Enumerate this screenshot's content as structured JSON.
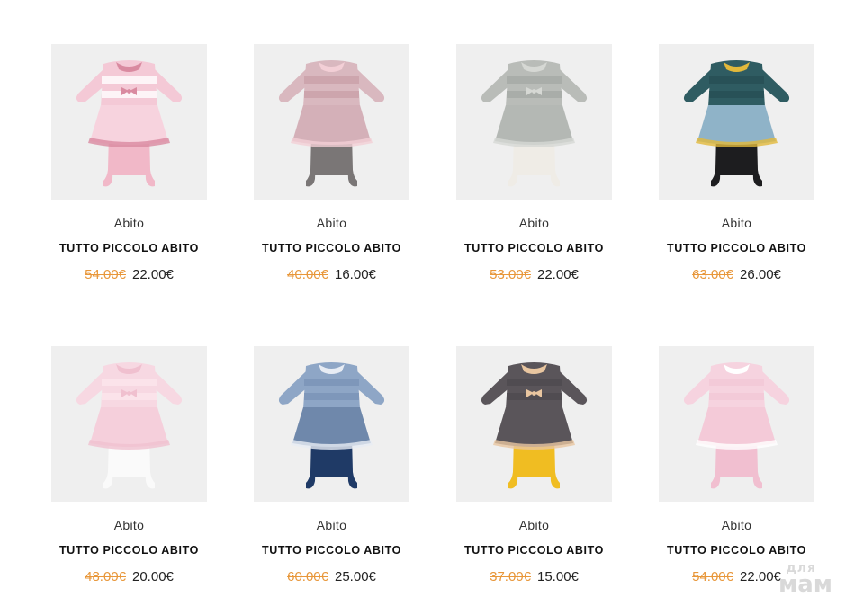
{
  "products": [
    {
      "category": "Abito",
      "brand": "TUTTO PICCOLO ABITO",
      "old_price": "54.00€",
      "price": "22.00€",
      "image": "pink-striped-tulle-dress",
      "colors": {
        "top": "#f4c9d6",
        "top2": "#ffffff",
        "skirt": "#f7d3de",
        "tights": "#f1b8c8",
        "accent": "#d98aa0"
      }
    },
    {
      "category": "Abito",
      "brand": "TUTTO PICCOLO ABITO",
      "old_price": "40.00€",
      "price": "16.00€",
      "image": "pink-houndstooth-dress",
      "colors": {
        "top": "#d9b8bf",
        "top2": "#c9a0a9",
        "skirt": "#d4b0b8",
        "tights": "#7a7676",
        "accent": "#f3cfd6"
      }
    },
    {
      "category": "Abito",
      "brand": "TUTTO PICCOLO ABITO",
      "old_price": "53.00€",
      "price": "22.00€",
      "image": "grey-check-dress",
      "colors": {
        "top": "#b9bcb8",
        "top2": "#a5a9a5",
        "skirt": "#b4b8b4",
        "tights": "#efece6",
        "accent": "#d6d8d4"
      }
    },
    {
      "category": "Abito",
      "brand": "TUTTO PICCOLO ABITO",
      "old_price": "63.00€",
      "price": "26.00€",
      "image": "teal-bow-dress",
      "colors": {
        "top": "#2f5c62",
        "top2": "#274f55",
        "skirt": "#8fb3c8",
        "tights": "#1d1d1f",
        "accent": "#e2b93b"
      }
    },
    {
      "category": "Abito",
      "brand": "TUTTO PICCOLO ABITO",
      "old_price": "48.00€",
      "price": "20.00€",
      "image": "light-pink-bow-dress",
      "colors": {
        "top": "#f7d8e2",
        "top2": "#fbe6ec",
        "skirt": "#f5cfdb",
        "tights": "#fafafa",
        "accent": "#f0c0cf"
      }
    },
    {
      "category": "Abito",
      "brand": "TUTTO PICCOLO ABITO",
      "old_price": "60.00€",
      "price": "25.00€",
      "image": "blue-knit-dress",
      "colors": {
        "top": "#8ea6c6",
        "top2": "#7a93b6",
        "skirt": "#6f88ab",
        "tights": "#1f3a66",
        "accent": "#e7ecf4"
      }
    },
    {
      "category": "Abito",
      "brand": "TUTTO PICCOLO ABITO",
      "old_price": "37.00€",
      "price": "15.00€",
      "image": "charcoal-star-dress",
      "colors": {
        "top": "#5a555a",
        "top2": "#4e4a4f",
        "skirt": "#5a555a",
        "tights": "#f0bd22",
        "accent": "#e9c6a0"
      }
    },
    {
      "category": "Abito",
      "brand": "TUTTO PICCOLO ABITO",
      "old_price": "54.00€",
      "price": "22.00€",
      "image": "pink-knit-frill-dress",
      "colors": {
        "top": "#f6d3df",
        "top2": "#f3c8d6",
        "skirt": "#f4cad8",
        "tights": "#f1bfd0",
        "accent": "#ffffff"
      }
    }
  ],
  "watermark": {
    "line1": "для",
    "line2": "мам"
  },
  "colors": {
    "old_price": "#e8973a",
    "image_bg": "#efefef"
  }
}
